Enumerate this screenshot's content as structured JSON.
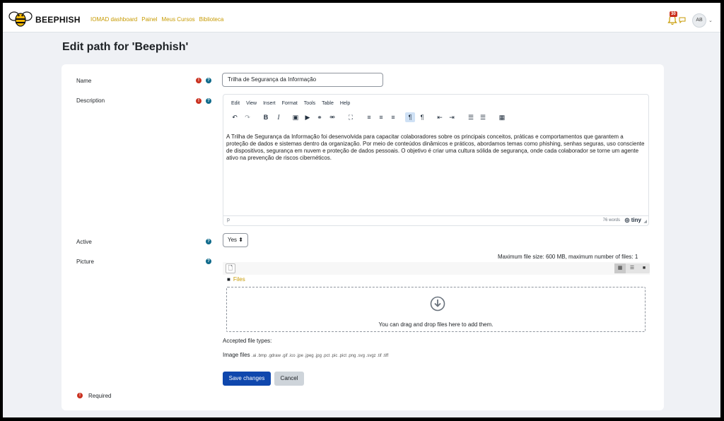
{
  "navbar": {
    "brand": "BEEPHISH",
    "links": [
      "IOMAD dashboard",
      "Painel",
      "Meus Cursos",
      "Biblioteca"
    ],
    "notification_count": "30",
    "user_initials": "AB"
  },
  "page": {
    "title": "Edit path for 'Beephish'"
  },
  "form": {
    "name": {
      "label": "Name",
      "value": "Trilha de Segurança da Informação"
    },
    "description": {
      "label": "Description",
      "menu": [
        "Edit",
        "View",
        "Insert",
        "Format",
        "Tools",
        "Table",
        "Help"
      ],
      "text": "A Trilha de Segurança da Informação foi desenvolvida para capacitar colaboradores sobre os principais conceitos, práticas e comportamentos que garantem a proteção de dados e sistemas dentro da organização. Por meio de conteúdos dinâmicos e práticos, abordamos temas como phishing, senhas seguras, uso consciente de dispositivos, segurança em nuvem e proteção de dados pessoais. O objetivo é criar uma cultura sólida de segurança, onde cada colaborador se torne um agente ativo na prevenção de riscos cibernéticos.",
      "path": "p",
      "word_count": "76 words",
      "brand": "tiny"
    },
    "active": {
      "label": "Active",
      "value": "Yes"
    },
    "picture": {
      "label": "Picture",
      "max_size": "Maximum file size: 600 MB, maximum number of files: 1",
      "folder_label": "Files",
      "drop_text": "You can drag and drop files here to add them.",
      "accepted_label": "Accepted file types:",
      "accepted_group": "Image files",
      "accepted_exts": ".ai .bmp .gdraw .gif .ico .jpe .jpeg .jpg .pct .pic .pict .png .svg .svgz .tif .tiff"
    },
    "buttons": {
      "save": "Save changes",
      "cancel": "Cancel"
    },
    "required_note": "Required"
  },
  "colors": {
    "primary": "#0f47ad",
    "required": "#ca3120",
    "help": "#0f6a8b",
    "link": "#c79a00"
  }
}
